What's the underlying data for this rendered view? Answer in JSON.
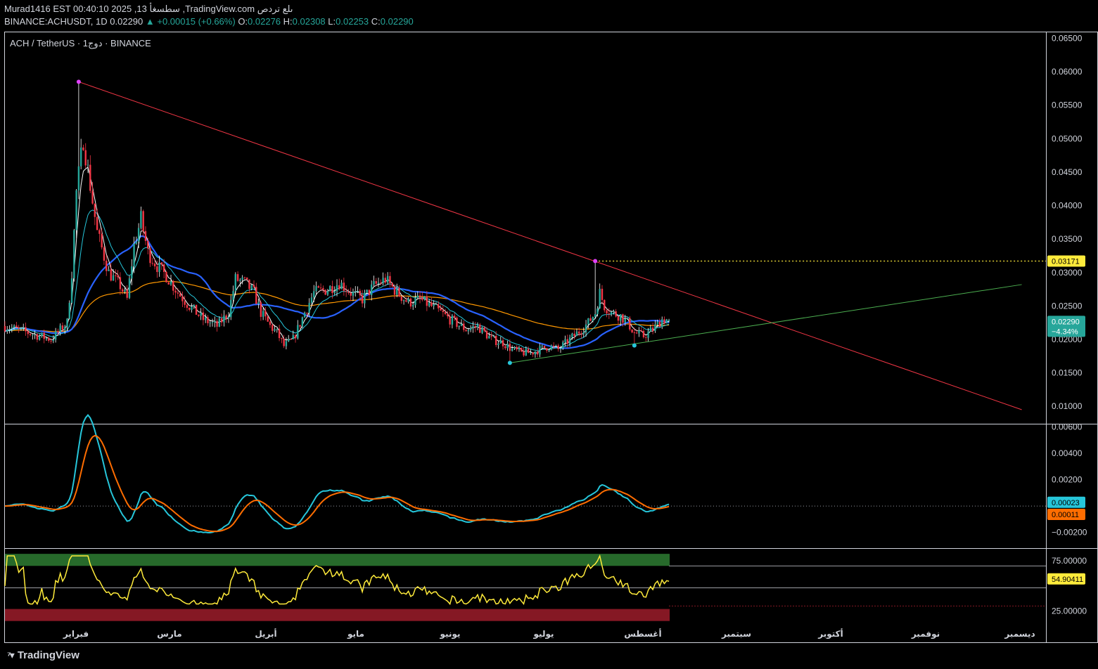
{
  "header": {
    "line1": "Murad1416 EST 00:40:10 2025 ,13 سطسغأ ,TradingView.com ىلع تردص",
    "symbol": "BINANCE:ACHUSDT, 1D",
    "close_price": "0.02290",
    "change": "▲ +0.00015 (+0.66%)",
    "o_label": "O:",
    "o_value": "0.02276",
    "h_label": "H:",
    "h_value": "0.02308",
    "l_label": "L:",
    "l_value": "0.02253",
    "c_label": "C:",
    "c_value": "0.02290"
  },
  "legend": "ACH / TetherUS · 1دوج · BINANCE",
  "brand": "TradingView",
  "colors": {
    "background": "#000000",
    "up": "#26a69a",
    "down": "#f23645",
    "resistance": "#f23645",
    "support": "#4caf50",
    "ma_blue": "#2962ff",
    "ma_orange": "#ff9800",
    "ma_teal": "#26c6da",
    "ma_white": "#ffffff",
    "macd": "#26c6da",
    "signal": "#ff6d00",
    "rsi": "#ffeb3b",
    "level_line": "#ffeb3b"
  },
  "chart_data": {
    "type": "candlestick",
    "x_labels": [
      "فبراير",
      "مارس",
      "أبريل",
      "مايو",
      "يونيو",
      "يوليو",
      "أغسطس",
      "سبتمبر",
      "أكتوبر",
      "نوفمبر",
      "ديسمبر"
    ],
    "price_axis": {
      "ticks": [
        "0.06500",
        "0.06000",
        "0.05500",
        "0.05000",
        "0.04500",
        "0.04000",
        "0.03500",
        "0.03000",
        "0.02500",
        "0.02000",
        "0.01500",
        "0.01000"
      ],
      "range": [
        0.0074,
        0.066
      ]
    },
    "price_path": [
      [
        0,
        0.022
      ],
      [
        10,
        0.021
      ],
      [
        20,
        0.02
      ],
      [
        27,
        0.0225
      ],
      [
        29,
        0.03
      ],
      [
        31,
        0.042
      ],
      [
        34,
        0.05
      ],
      [
        37,
        0.043
      ],
      [
        40,
        0.036
      ],
      [
        45,
        0.03
      ],
      [
        50,
        0.028
      ],
      [
        53,
        0.026
      ],
      [
        56,
        0.034
      ],
      [
        59,
        0.038
      ],
      [
        62,
        0.033
      ],
      [
        66,
        0.031
      ],
      [
        70,
        0.0295
      ],
      [
        75,
        0.027
      ],
      [
        80,
        0.025
      ],
      [
        86,
        0.023
      ],
      [
        92,
        0.022
      ],
      [
        97,
        0.024
      ],
      [
        100,
        0.029
      ],
      [
        104,
        0.0285
      ],
      [
        108,
        0.027
      ],
      [
        111,
        0.024
      ],
      [
        115,
        0.022
      ],
      [
        118,
        0.021
      ],
      [
        121,
        0.019
      ],
      [
        125,
        0.02
      ],
      [
        130,
        0.024
      ],
      [
        134,
        0.027
      ],
      [
        140,
        0.0275
      ],
      [
        145,
        0.0285
      ],
      [
        150,
        0.027
      ],
      [
        155,
        0.026
      ],
      [
        160,
        0.028
      ],
      [
        165,
        0.029
      ],
      [
        170,
        0.027
      ],
      [
        175,
        0.0255
      ],
      [
        180,
        0.026
      ],
      [
        187,
        0.0245
      ],
      [
        193,
        0.023
      ],
      [
        200,
        0.0215
      ],
      [
        205,
        0.022
      ],
      [
        211,
        0.02
      ],
      [
        216,
        0.0195
      ],
      [
        220,
        0.0185
      ],
      [
        224,
        0.018
      ],
      [
        228,
        0.018
      ],
      [
        232,
        0.0185
      ],
      [
        236,
        0.019
      ],
      [
        240,
        0.0185
      ],
      [
        245,
        0.02
      ],
      [
        250,
        0.0215
      ],
      [
        253,
        0.0225
      ],
      [
        256,
        0.024
      ],
      [
        258,
        0.027
      ],
      [
        260,
        0.025
      ],
      [
        263,
        0.024
      ],
      [
        267,
        0.0235
      ],
      [
        270,
        0.0225
      ],
      [
        273,
        0.021
      ],
      [
        277,
        0.0205
      ],
      [
        281,
        0.0215
      ],
      [
        285,
        0.023
      ],
      [
        288,
        0.0229
      ]
    ],
    "last_index": 288,
    "price_labels": {
      "level": "0.03171",
      "current": "0.02290",
      "change_pct": "−4.34%"
    },
    "level_price": 0.03171,
    "resistance_line": {
      "from": [
        32,
        0.0585
      ],
      "to": [
        441,
        0.0095
      ]
    },
    "support_line": {
      "from": [
        219,
        0.0165
      ],
      "to": [
        441,
        0.0282
      ]
    },
    "pivots": [
      {
        "i": 32,
        "price": 0.0585,
        "kind": "high"
      },
      {
        "i": 256,
        "price": 0.03171,
        "kind": "high"
      },
      {
        "i": 219,
        "price": 0.0165,
        "kind": "low"
      },
      {
        "i": 273,
        "price": 0.0191,
        "kind": "low"
      }
    ],
    "macd_axis": {
      "ticks": [
        "0.00600",
        "0.00400",
        "0.00200",
        "−0.00200"
      ],
      "range": [
        -0.0032,
        0.0062
      ]
    },
    "macd_labels": {
      "macd": "0.00023",
      "signal": "0.00011"
    },
    "rsi_axis": {
      "ticks": [
        "75.00000",
        "25.00000"
      ],
      "range": [
        12,
        87
      ]
    },
    "rsi_label": "54.90411",
    "rsi_overbought": 70,
    "rsi_oversold": 30
  }
}
